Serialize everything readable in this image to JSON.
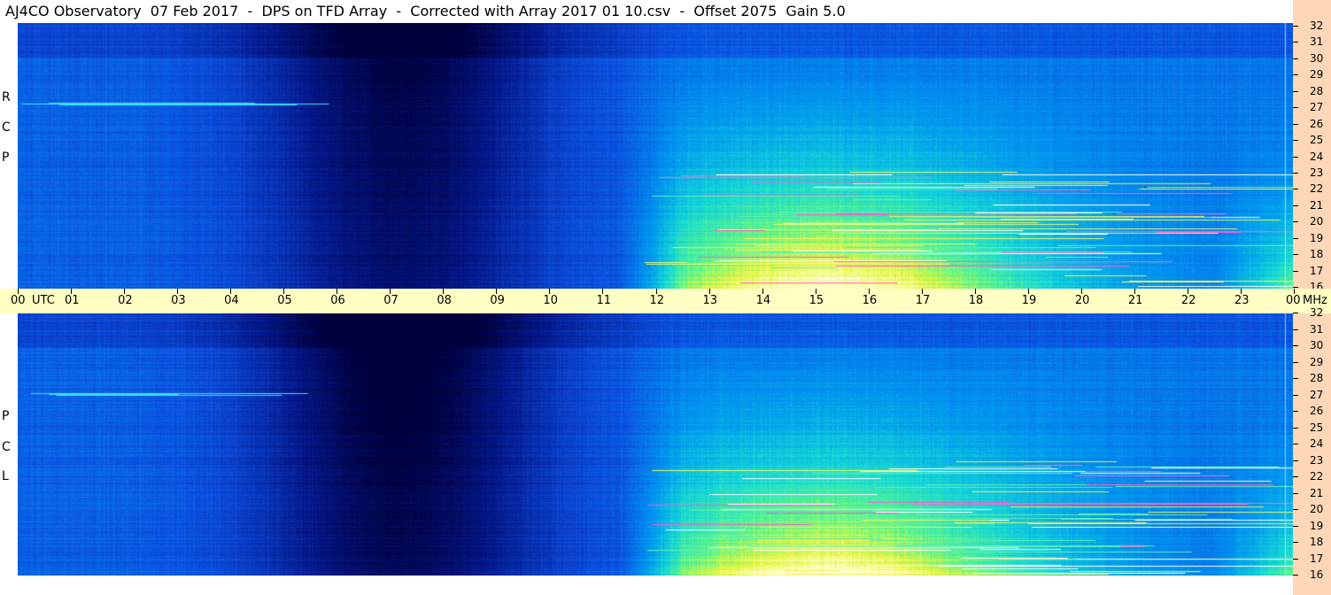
{
  "title": "AJ4CO Observatory  07 Feb 2017  -  DPS on TFD Array  -  Corrected with Array 2017 01 10.csv  -  Offset 2075  Gain 5.0",
  "colors": {
    "background": "#ffffff",
    "time_axis_bg": "#ffffc4",
    "freq_axis_bg": "#fdd7b8",
    "colormap": [
      "#00004a",
      "#0a2a9e",
      "#0f5ee3",
      "#00b0f0",
      "#40f0a0",
      "#f0f040",
      "#ff40c0",
      "#ffffff"
    ]
  },
  "chart_data": {
    "type": "heatmap",
    "description_panels": [
      {
        "name": "RCP",
        "label_chars": [
          "R",
          "C",
          "P"
        ]
      },
      {
        "name": "LCP",
        "label_chars": [
          "L",
          "C",
          "P"
        ]
      }
    ],
    "x": {
      "unit_label": "UTC",
      "range": [
        0,
        24
      ],
      "tick_labels": [
        "00",
        "01",
        "02",
        "03",
        "04",
        "05",
        "06",
        "07",
        "08",
        "09",
        "10",
        "11",
        "12",
        "13",
        "14",
        "15",
        "16",
        "17",
        "18",
        "19",
        "20",
        "21",
        "22",
        "23",
        "00"
      ]
    },
    "y": {
      "unit_label": "MHz",
      "range": [
        16,
        32
      ],
      "tick_labels": [
        "32",
        "31",
        "30",
        "29",
        "28",
        "27",
        "26",
        "25",
        "24",
        "23",
        "22",
        "21",
        "20",
        "19",
        "18",
        "17",
        "16"
      ]
    }
  }
}
